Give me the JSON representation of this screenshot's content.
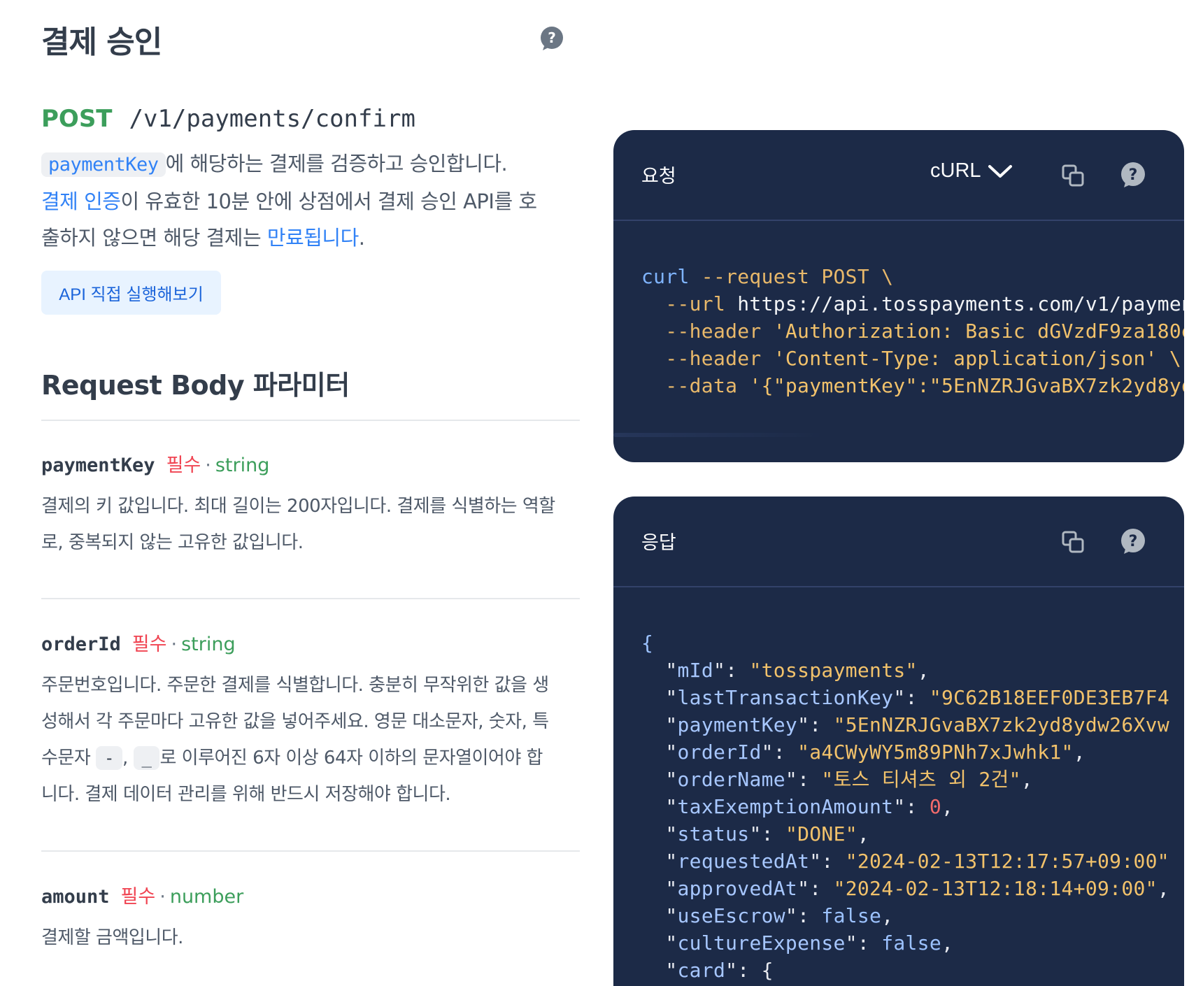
{
  "page": {
    "title": "결제 승인",
    "method": "POST",
    "path": "/v1/payments/confirm",
    "description": {
      "chip": "paymentKey",
      "text1": "에 해당하는 결제를 검증하고 승인합니다.",
      "link1": "결제 인증",
      "text2": "이 유효한 10분 안에 상점에서 결제 승인 API를 호출하지 않으면 해당 결제는 ",
      "link2": "만료됩니다",
      "text3": "."
    },
    "try_button": "API 직접 실행해보기",
    "section_title": "Request Body 파라미터"
  },
  "params": [
    {
      "name": "paymentKey",
      "required": "필수",
      "dot": "·",
      "type": "string",
      "desc": "결제의 키 값입니다. 최대 길이는 200자입니다. 결제를 식별하는 역할로, 중복되지 않는 고유한 값입니다."
    },
    {
      "name": "orderId",
      "required": "필수",
      "dot": "·",
      "type": "string",
      "desc_a": "주문번호입니다. 주문한 결제를 식별합니다. 충분히 무작위한 값을 생성해서 각 주문마다 고유한 값을 넣어주세요. 영문 대소문자, 숫자, 특수문자 ",
      "chip1": "-",
      "sep": ", ",
      "chip2": "_",
      "desc_b": "로 이루어진 6자 이상 64자 이하의 문자열이어야 합니다. 결제 데이터 관리를 위해 반드시 저장해야 합니다."
    },
    {
      "name": "amount",
      "required": "필수",
      "dot": "·",
      "type": "number",
      "desc": "결제할 금액입니다."
    }
  ],
  "request_panel": {
    "title": "요청",
    "language": "cURL",
    "code": {
      "l1_cmd": "curl",
      "l1_rest": " --request POST \\",
      "l2_flag": "  --url ",
      "l2_val": "https://api.tosspayments.com/v1/paymen",
      "l3_flag": "  --header ",
      "l3_val": "'Authorization: Basic dGVzdF9za180e",
      "l4_flag": "  --header ",
      "l4_val": "'Content-Type: application/json' \\",
      "l5_flag": "  --data ",
      "l5_val": "'{\"paymentKey\":\"5EnNZRJGvaBX7zk2yd8yd"
    }
  },
  "response_panel": {
    "title": "응답",
    "lines": [
      {
        "key": "mId",
        "val": "\"tosspayments\"",
        "kind": "str",
        "tail": ","
      },
      {
        "key": "lastTransactionKey",
        "val": "\"9C62B18EEF0DE3EB7F4",
        "kind": "str",
        "tail": ""
      },
      {
        "key": "paymentKey",
        "val": "\"5EnNZRJGvaBX7zk2yd8ydw26Xvw",
        "kind": "str",
        "tail": ""
      },
      {
        "key": "orderId",
        "val": "\"a4CWyWY5m89PNh7xJwhk1\"",
        "kind": "str",
        "tail": ","
      },
      {
        "key": "orderName",
        "val": "\"토스 티셔츠 외 2건\"",
        "kind": "str",
        "tail": ","
      },
      {
        "key": "taxExemptionAmount",
        "val": "0",
        "kind": "num",
        "tail": ","
      },
      {
        "key": "status",
        "val": "\"DONE\"",
        "kind": "str",
        "tail": ","
      },
      {
        "key": "requestedAt",
        "val": "\"2024-02-13T12:17:57+09:00\"",
        "kind": "str",
        "tail": ""
      },
      {
        "key": "approvedAt",
        "val": "\"2024-02-13T12:18:14+09:00\"",
        "kind": "str",
        "tail": ","
      },
      {
        "key": "useEscrow",
        "val": "false",
        "kind": "bool",
        "tail": ","
      },
      {
        "key": "cultureExpense",
        "val": "false",
        "kind": "bool",
        "tail": ","
      },
      {
        "key": "card",
        "val": "{",
        "kind": "plain",
        "tail": ""
      }
    ],
    "open_brace": "{"
  },
  "icons": {
    "help": "question-circle-icon",
    "copy": "copy-icon",
    "chevron": "chevron-down-icon"
  },
  "colors": {
    "accent_blue": "#3182f6",
    "post_green": "#3c9e5b",
    "required_red": "#f04452",
    "panel_bg": "#1c2a47"
  }
}
